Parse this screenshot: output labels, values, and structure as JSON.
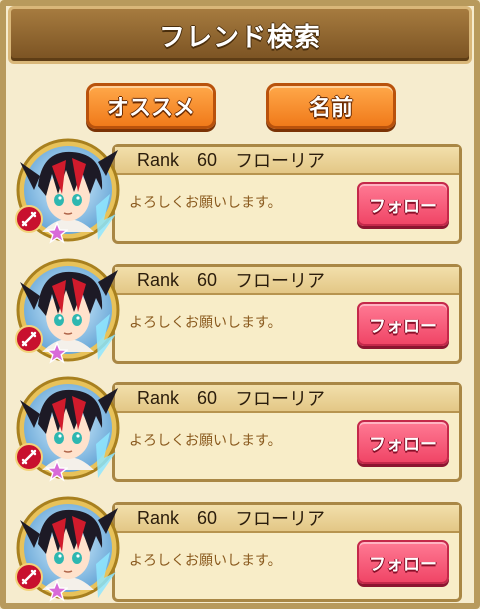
{
  "header": {
    "title": "フレンド検索"
  },
  "tabs": [
    {
      "label": "オススメ"
    },
    {
      "label": "名前"
    }
  ],
  "friends": [
    {
      "rank_label": "Rank",
      "rank": "60",
      "name": "フローリア",
      "message": "よろしくお願いします。",
      "follow_label": "フォロー"
    },
    {
      "rank_label": "Rank",
      "rank": "60",
      "name": "フローリア",
      "message": "よろしくお願いします。",
      "follow_label": "フォロー"
    },
    {
      "rank_label": "Rank",
      "rank": "60",
      "name": "フローリア",
      "message": "よろしくお願いします。",
      "follow_label": "フォロー"
    },
    {
      "rank_label": "Rank",
      "rank": "60",
      "name": "フローリア",
      "message": "よろしくお願いします。",
      "follow_label": "フォロー"
    }
  ],
  "colors": {
    "title_bar": "#8b6128",
    "tab_orange": "#f58a2a",
    "follow_pink": "#f04566",
    "card_bg": "#f8edc8",
    "element_red": "#c8102e",
    "star_pink": "#d86ad8"
  },
  "icons": {
    "element": "fire-element-icon",
    "rarity": "star-icon"
  }
}
